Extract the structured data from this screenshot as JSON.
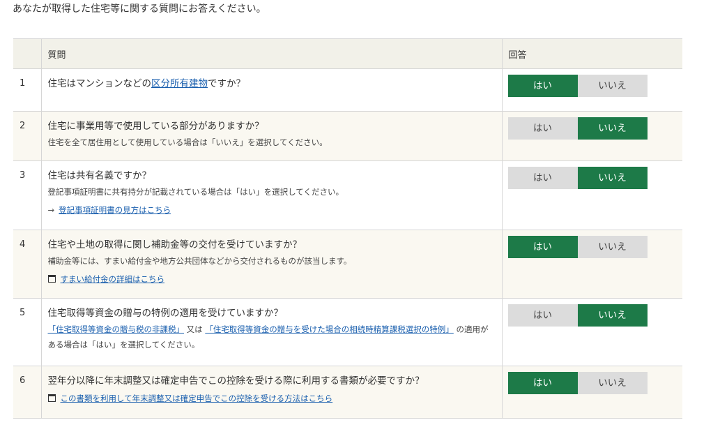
{
  "intro": "あなたが取得した住宅等に関する質問にお答えください。",
  "headers": {
    "num": "",
    "question": "質問",
    "answer": "回答"
  },
  "buttons": {
    "yes": "はい",
    "no": "いいえ"
  },
  "colors": {
    "selected": "#1d7a48",
    "unselected": "#dcdcdc",
    "header_bg": "#f2f1e9",
    "link": "#1a5fae"
  },
  "rows": [
    {
      "num": "1",
      "q_pre": "住宅はマンションなどの",
      "q_link": "区分所有建物",
      "q_post": "ですか？",
      "selected": "yes"
    },
    {
      "num": "2",
      "question": "住宅に事業用等で使用している部分がありますか？",
      "note": "住宅を全て居住用として使用している場合は「いいえ」を選択してください。",
      "selected": "no"
    },
    {
      "num": "3",
      "question": "住宅は共有名義ですか？",
      "note": "登記事項証明書に共有持分が記載されている場合は「はい」を選択してください。",
      "link": "登記事項証明書の見方はこちら",
      "link_icon": "arrow-right-icon",
      "selected": "no"
    },
    {
      "num": "4",
      "question": "住宅や土地の取得に関し補助金等の交付を受けていますか？",
      "note": "補助金等には、すまい給付金や地方公共団体などから交付されるものが該当します。",
      "link": "すまい給付金の詳細はこちら",
      "link_icon": "new-window-icon",
      "selected": "yes"
    },
    {
      "num": "5",
      "question": "住宅取得等資金の贈与の特例の適用を受けていますか？",
      "note_link1": "「住宅取得等資金の贈与税の非課税」",
      "note_mid": "又は",
      "note_link2": "「住宅取得等資金の贈与を受けた場合の相続時精算課税選択の特例」",
      "note_end": "の適用がある場合は「はい」を選択してください。",
      "selected": "no"
    },
    {
      "num": "6",
      "question": "翌年分以降に年末調整又は確定申告でこの控除を受ける際に利用する書類が必要ですか？",
      "link": "この書類を利用して年末調整又は確定申告でこの控除を受ける方法はこちら",
      "link_icon": "new-window-icon",
      "selected": "yes"
    }
  ]
}
